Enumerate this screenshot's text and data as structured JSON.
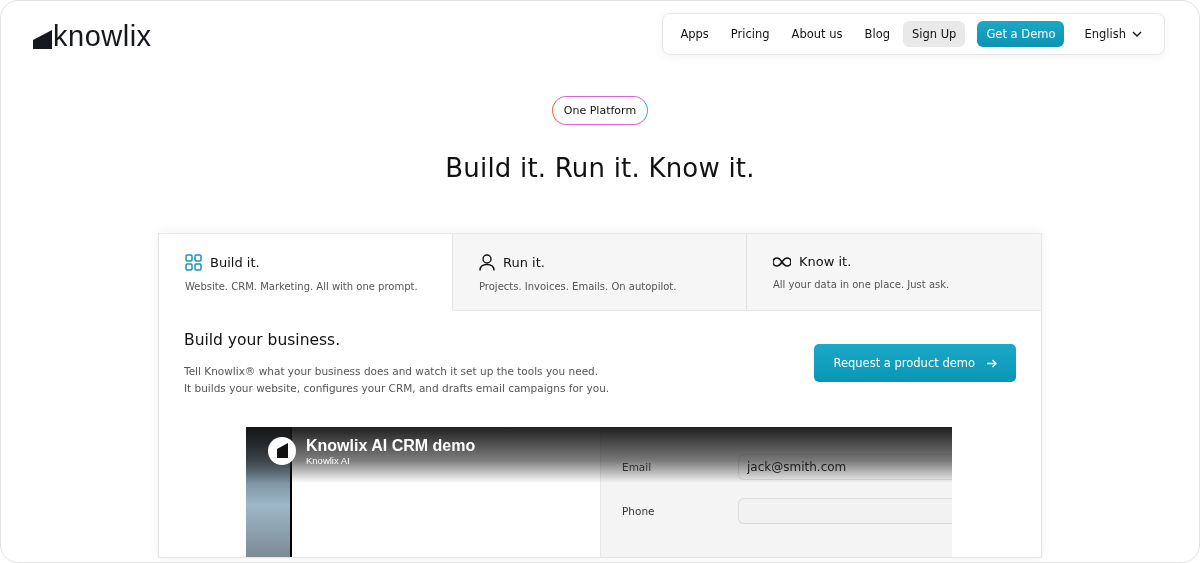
{
  "header": {
    "logo": "knowlix",
    "nav": [
      {
        "label": "Apps",
        "kind": "link"
      },
      {
        "label": "Pricing",
        "kind": "link"
      },
      {
        "label": "About us",
        "kind": "link"
      },
      {
        "label": "Blog",
        "kind": "link"
      },
      {
        "label": "Sign Up",
        "kind": "secondary"
      },
      {
        "label": "Get a Demo",
        "kind": "primary"
      }
    ],
    "language": "English"
  },
  "hero": {
    "badge": "One Platform",
    "title": "Build it. Run it. Know it."
  },
  "tabs": [
    {
      "kind": "grid",
      "title": "Build it.",
      "subtitle": "Website. CRM. Marketing. All with one prompt.",
      "selected": true
    },
    {
      "kind": "person",
      "title": "Run it.",
      "subtitle": "Projects. Invoices. Emails. On autopilot.",
      "selected": false
    },
    {
      "kind": "infinity",
      "title": "Know it.",
      "subtitle": "All your data in one place. Just ask.",
      "selected": false
    }
  ],
  "panel": {
    "title": "Build your business.",
    "lines": [
      "Tell Knowlix® what your business does and watch it set up the tools you need.",
      "It builds your website, configures your CRM, and drafts email campaigns for you."
    ],
    "button": "Request a product demo"
  },
  "video": {
    "title": "Knowlix AI CRM demo",
    "channel": "Knowlix AI",
    "fields": [
      {
        "label": "Email",
        "value": "jack@smith.com"
      },
      {
        "label": "Phone"
      }
    ]
  }
}
